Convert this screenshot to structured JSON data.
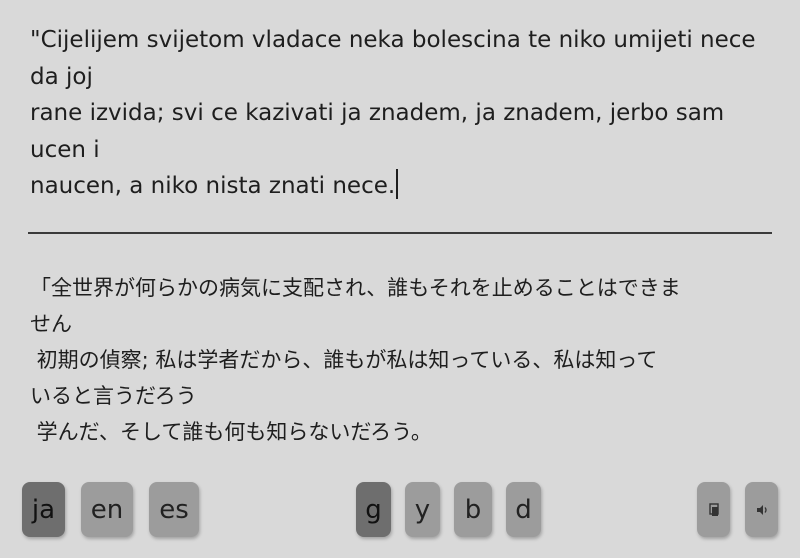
{
  "source_text": {
    "lines": [
      "\"Cijelijem svijetom vladace neka bolescina te niko umijeti nece",
      "da joj",
      "rane izvida; svi ce kazivati ja znadem, ja znadem, jerbo sam",
      "ucen i",
      "naucen, a niko nista znati nece."
    ]
  },
  "translation_text": {
    "lines": [
      "「全世界が何らかの病気に支配され、誰もそれを止めることはできま",
      "せん",
      " 初期の偵察; 私は学者だから、誰もが私は知っている、私は知って",
      "いると言うだろう",
      " 学んだ、そして誰も何も知らないだろう。"
    ]
  },
  "language_buttons": [
    {
      "label": "ja",
      "active": true
    },
    {
      "label": "en",
      "active": false
    },
    {
      "label": "es",
      "active": false
    }
  ],
  "mode_buttons": [
    {
      "label": "g",
      "active": true
    },
    {
      "label": "y",
      "active": false
    },
    {
      "label": "b",
      "active": false
    },
    {
      "label": "d",
      "active": false
    }
  ],
  "tool_buttons": [
    {
      "icon": "copy-icon"
    },
    {
      "icon": "speaker-icon"
    }
  ]
}
